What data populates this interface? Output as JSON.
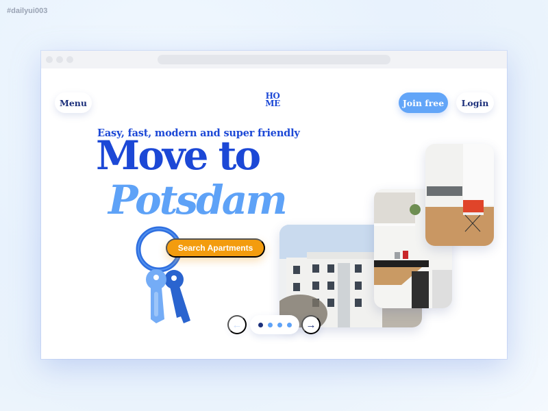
{
  "tag": "#dailyui003",
  "nav": {
    "menu_label": "Menu",
    "logo_line1": "HO",
    "logo_line2": "ME",
    "join_label": "Join free",
    "login_label": "Login"
  },
  "hero": {
    "tagline": "Easy, fast, modern and super friendly",
    "title_line1": "Move to",
    "title_line2": "Potsdam",
    "cta_label": "Search Apartments"
  },
  "carousel": {
    "prev_icon": "arrow-left-icon",
    "next_icon": "arrow-right-icon",
    "prev_glyph": "←",
    "next_glyph": "→",
    "slide_count": 4,
    "active_index": 0,
    "photos": [
      "apartment-building-photo",
      "kitchen-photo",
      "living-room-photo"
    ]
  },
  "colors": {
    "primary_dark": "#1c48d6",
    "primary_light": "#5ea2f7",
    "navy": "#1b2f7a",
    "accent_orange": "#f39c0e"
  }
}
